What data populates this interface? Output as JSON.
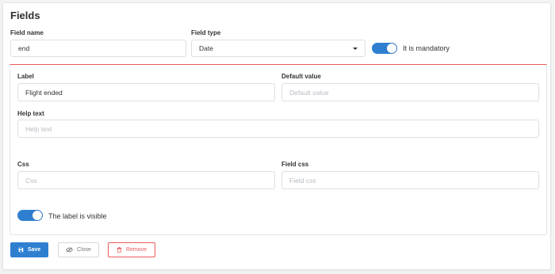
{
  "title": "Fields",
  "field_name": {
    "label": "Field name",
    "value": "end"
  },
  "field_type": {
    "label": "Field type",
    "selected": "Date"
  },
  "mandatory": {
    "label": "It is mandatory",
    "on": true
  },
  "label": {
    "label": "Label",
    "value": "Flight ended"
  },
  "default_value": {
    "label": "Default value",
    "placeholder": "Default value"
  },
  "help_text": {
    "label": "Help text",
    "placeholder": "Help text"
  },
  "css": {
    "label": "Css",
    "placeholder": "Css"
  },
  "field_css": {
    "label": "Field css",
    "placeholder": "Field css"
  },
  "label_visible": {
    "label": "The label is visible",
    "on": true
  },
  "buttons": {
    "save": "Save",
    "close": "Close",
    "remove": "Remove"
  },
  "colors": {
    "accent": "#2f7fd1",
    "danger": "#e85b5b"
  },
  "icons": {
    "save": "floppy-disk-icon",
    "close": "eye-slash-icon",
    "remove": "trash-icon"
  }
}
